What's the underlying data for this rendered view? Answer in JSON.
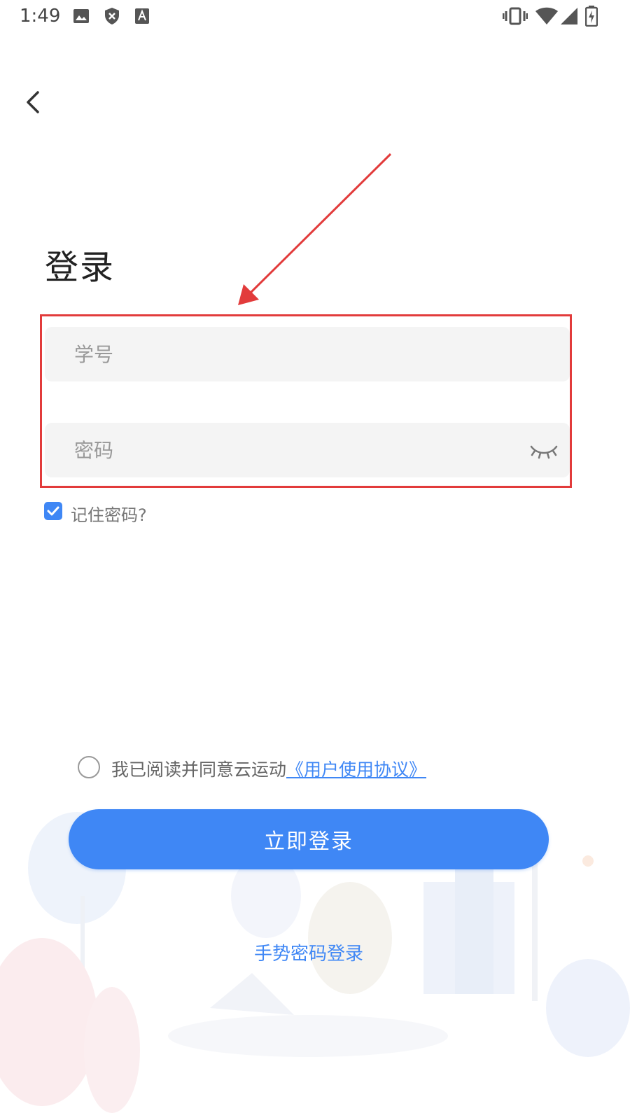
{
  "status_bar": {
    "time": "1:49",
    "left_icons": [
      "image-icon",
      "shield-x-icon",
      "text-a-icon"
    ],
    "right_icons": [
      "vibrate-icon",
      "wifi-icon",
      "signal-icon",
      "battery-charging-icon"
    ]
  },
  "page": {
    "title": "登录"
  },
  "form": {
    "student_id_placeholder": "学号",
    "student_id_value": "",
    "password_placeholder": "密码",
    "password_value": "",
    "remember_label": "记住密码?",
    "remember_checked": true
  },
  "agreement": {
    "text": "我已阅读并同意云运动",
    "link": "《用户使用协议》",
    "checked": false
  },
  "actions": {
    "login_label": "立即登录",
    "gesture_login_label": "手势密码登录"
  },
  "colors": {
    "accent": "#3f87f5",
    "annotation": "#e23b3b",
    "field_bg": "#f4f4f4"
  }
}
